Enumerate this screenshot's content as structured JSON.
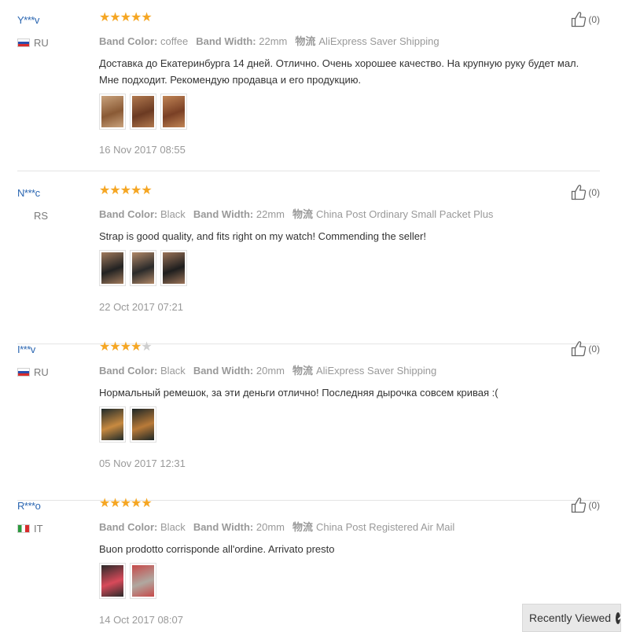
{
  "reviews": [
    {
      "user": "Y***v",
      "country": "RU",
      "flag": "ru",
      "rating": 5,
      "band_color_label": "Band Color:",
      "band_color": "coffee",
      "band_width_label": "Band Width:",
      "band_width": "22mm",
      "shipping_label": "物流",
      "shipping": "AliExpress Saver Shipping",
      "text": "Доставка до Екатеринбурга 14 дней. Отлично. Очень хорошее качество. На крупную руку будет мал. Мне подходит. Рекомендую продавца и его продукцию.",
      "photos": [
        {
          "color": "#8a5a35",
          "color2": "#c9a27c"
        },
        {
          "color": "#6b3a22",
          "color2": "#b0784e"
        },
        {
          "color": "#7a4025",
          "color2": "#c08455"
        }
      ],
      "date": "16 Nov 2017 08:55",
      "helpful": "(0)"
    },
    {
      "user": "N***c",
      "country": "RS",
      "flag": "none",
      "rating": 5,
      "band_color_label": "Band Color:",
      "band_color": "Black",
      "band_width_label": "Band Width:",
      "band_width": "22mm",
      "shipping_label": "物流",
      "shipping": "China Post Ordinary Small Packet Plus",
      "text": "Strap is good quality, and fits right on my watch! Commending the seller!",
      "photos": [
        {
          "color": "#222222",
          "color2": "#a07a5c"
        },
        {
          "color": "#2a2a2a",
          "color2": "#b08868"
        },
        {
          "color": "#1e1e1e",
          "color2": "#9a7358"
        }
      ],
      "date": "22 Oct 2017 07:21",
      "helpful": "(0)"
    },
    {
      "user": "I***v",
      "country": "RU",
      "flag": "ru",
      "rating": 4,
      "band_color_label": "Band Color:",
      "band_color": "Black",
      "band_width_label": "Band Width:",
      "band_width": "20mm",
      "shipping_label": "物流",
      "shipping": "AliExpress Saver Shipping",
      "text": "Нормальный ремешок, за эти деньги отлично! Последняя дырочка совсем кривая :(",
      "photos": [
        {
          "color": "#c88a40",
          "color2": "#1f2a2a"
        },
        {
          "color": "#b97a38",
          "color2": "#1c2626"
        }
      ],
      "date": "05 Nov 2017 12:31",
      "helpful": "(0)"
    },
    {
      "user": "R***o",
      "country": "IT",
      "flag": "it",
      "rating": 5,
      "band_color_label": "Band Color:",
      "band_color": "Black",
      "band_width_label": "Band Width:",
      "band_width": "20mm",
      "shipping_label": "物流",
      "shipping": "China Post Registered Air Mail",
      "text": "Buon prodotto corrisponde all'ordine. Arrivato presto",
      "photos": [
        {
          "color": "#d84a5a",
          "color2": "#2a2a2a"
        },
        {
          "color": "#b0a8a0",
          "color2": "#c64a4a"
        }
      ],
      "date": "14 Oct 2017 08:07",
      "helpful": "(0)"
    }
  ],
  "recently_viewed": {
    "label": "Recently Viewed",
    "icon": "chevron-up-circle-icon"
  },
  "colors": {
    "user_name": "#2b66b1",
    "star_on": "#f5a623",
    "star_off": "#cfcfcf",
    "muted": "#999999"
  }
}
